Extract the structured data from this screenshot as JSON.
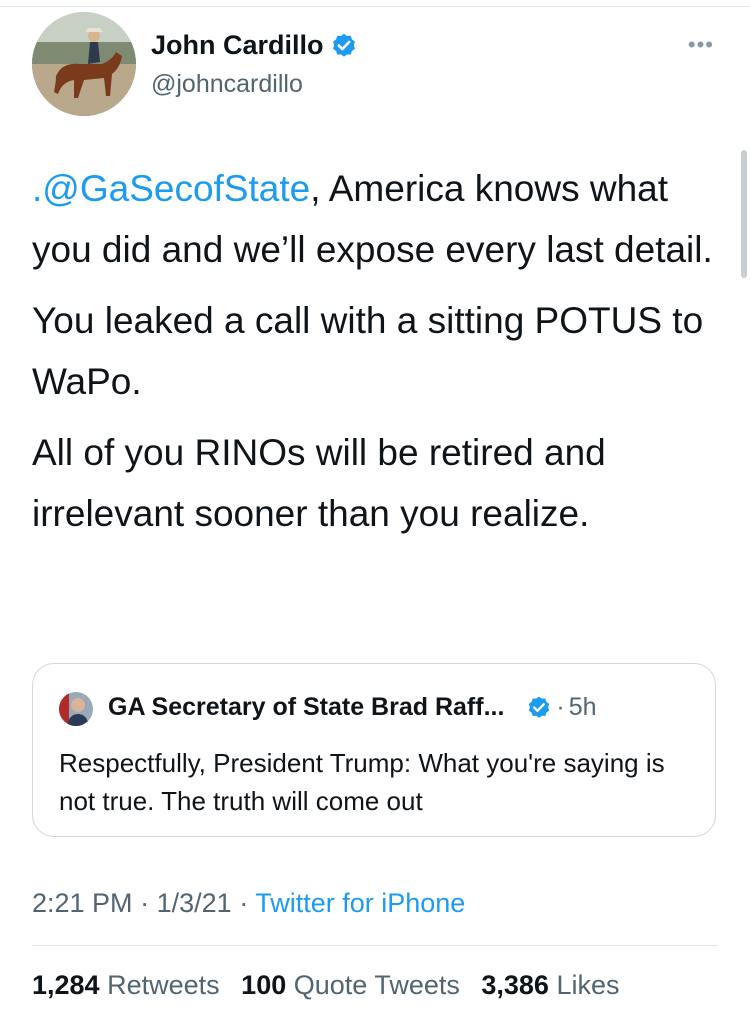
{
  "author": {
    "name": "John Cardillo",
    "handle": "@johncardillo",
    "verified": true
  },
  "more_icon": "more-dots-icon",
  "tweet": {
    "mention": ".@GaSecofState",
    "paragraph1_rest": ", America knows what you did and we’ll expose every last detail.",
    "paragraph2": "You leaked a call with a sitting POTUS to WaPo.",
    "paragraph3": "All of you RINOs will be retired and irrelevant sooner than you realize."
  },
  "quoted_tweet": {
    "author_name": "GA Secretary of State Brad Raff...",
    "verified": true,
    "separator": "·",
    "time": "5h",
    "text": "Respectfully, President Trump: What you're saying is not true. The truth will come out"
  },
  "meta": {
    "time": "2:21 PM",
    "sep1": "·",
    "date": "1/3/21",
    "sep2": "·",
    "source": "Twitter for iPhone"
  },
  "stats": {
    "retweets_count": "1,284",
    "retweets_label": "Retweets",
    "quotes_count": "100",
    "quotes_label": "Quote Tweets",
    "likes_count": "3,386",
    "likes_label": "Likes"
  },
  "colors": {
    "accent": "#1d9bf0",
    "text": "#0f1419",
    "secondary": "#536471",
    "border": "#cfd9de"
  }
}
